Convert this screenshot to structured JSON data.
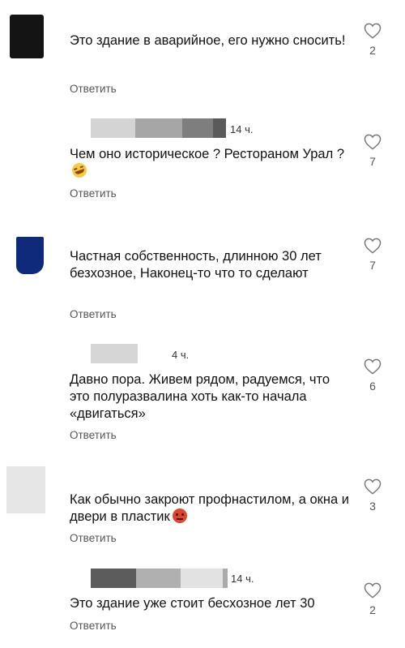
{
  "reply_label": "Ответить",
  "comments": [
    {
      "text": "Это здание в аварийное, его нужно сносить!",
      "likes": "2"
    },
    {
      "time": "14 ч.",
      "text": "Чем оно историческое ? Рестораном Урал ?",
      "emoji": "rolling-on-floor-laughing-emoji",
      "likes": "7"
    },
    {
      "text": "Частная собственность, длинною 30 лет безхозное, Наконец-то что то сделают",
      "likes": "7"
    },
    {
      "time": "4 ч.",
      "text": "Давно пора. Живем рядом, радуемся, что это полуразвалина хоть как-то начала «двигаться»",
      "likes": "6"
    },
    {
      "text": "Как обычно закроют профнастилом, а окна и двери в пластик",
      "emoji": "angry-face-emoji",
      "likes": "3"
    },
    {
      "time": "14 ч.",
      "text": "Это здание уже стоит бесхозное лет 30",
      "likes": "2"
    }
  ],
  "colors": {
    "avatar_black": "#141414",
    "avatar_navy": "#0f2a7a",
    "avatar_gray": "#e6e6e6",
    "emoji_yellow": "#f7c948",
    "emoji_red": "#e0452b"
  }
}
